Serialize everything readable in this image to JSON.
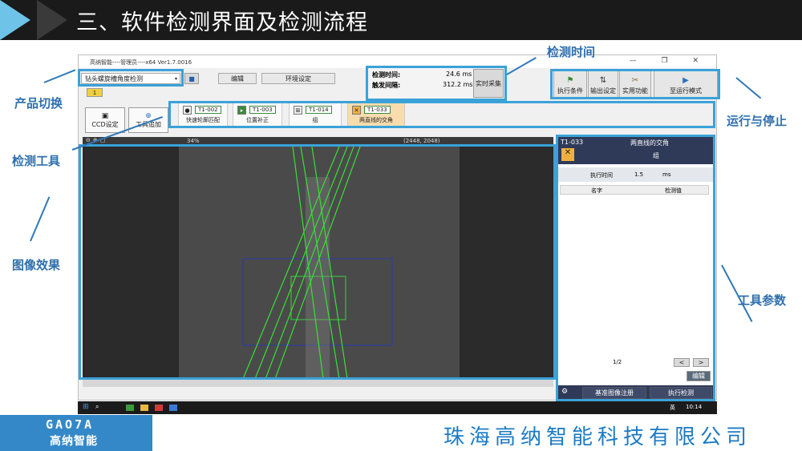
{
  "slide": {
    "title": "三、软件检测界面及检测流程",
    "company": "珠海高纳智能科技有限公司",
    "logo_top": "GAO7A",
    "logo_bottom": "高纳智能"
  },
  "annotations": {
    "product_switch": "产品切换",
    "detect_tool": "检测工具",
    "image_effect": "图像效果",
    "detect_time": "检测时间",
    "run_stop": "运行与停止",
    "tool_params": "工具参数"
  },
  "window": {
    "title": "高纳智能----管理员----x64 Ver1.7.0016",
    "controls": "— ❐ ✕",
    "product_select": "钻头螺旋槽角度检测",
    "tab_badge": "1",
    "menu_edit": "编辑",
    "menu_env": "环境设定",
    "detect_time_label": "检测时间:",
    "detect_time_value": "24.6 ms",
    "trigger_label": "触发间隔:",
    "trigger_value": "312.2 ms",
    "realtime_btn": "实时采集",
    "exec_cond": "执行条件",
    "output_set": "输出设定",
    "util": "实用功能",
    "run_mode": "至运行模式",
    "ccd_set": "CCD设定",
    "tool_add": "工具追加",
    "zoom": "34%",
    "resolution": "(2448, 2048)"
  },
  "tools": [
    {
      "id": "T1-002",
      "label": "快速轮廓匹配"
    },
    {
      "id": "T1-003",
      "label": "位置补正"
    },
    {
      "id": "T1-014",
      "label": "组"
    },
    {
      "id": "T1-033",
      "label": "两直线的交角"
    }
  ],
  "panel": {
    "tool_id": "T1-033",
    "tool_name": "两直线的交角",
    "group": "组",
    "exec_time_label": "执行时间",
    "exec_time_value": "1.5",
    "exec_time_unit": "ms",
    "col_name": "名字",
    "col_value": "检测值",
    "page": "1/2",
    "prev": "<",
    "next": ">",
    "edit": "编辑",
    "register": "基准图像注册",
    "run_detect": "执行检测"
  },
  "taskbar": {
    "lang": "英",
    "time": "10:14"
  }
}
